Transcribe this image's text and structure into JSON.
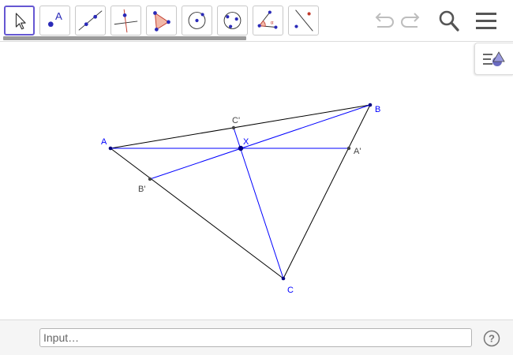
{
  "toolbar": {
    "tools": [
      {
        "name": "move-tool",
        "selected": true
      },
      {
        "name": "point-tool",
        "glyph": "A"
      },
      {
        "name": "line-tool"
      },
      {
        "name": "perpendicular-line-tool"
      },
      {
        "name": "polygon-tool"
      },
      {
        "name": "circle-center-point-tool"
      },
      {
        "name": "circle-three-points-tool"
      },
      {
        "name": "angle-tool",
        "glyph": "α"
      },
      {
        "name": "reflect-tool"
      }
    ],
    "right_icons": [
      "undo-icon",
      "redo-icon",
      "search-icon",
      "menu-icon"
    ]
  },
  "construction": {
    "points": [
      "A",
      "B",
      "C",
      "A'",
      "B'",
      "C'",
      "X"
    ],
    "colors": {
      "triangle": "#000000",
      "cevians": "#0000ff",
      "main_points": "#0000ff",
      "derived_points": "#444444"
    }
  },
  "input_bar": {
    "placeholder": "Input…",
    "help_glyph": "?"
  }
}
